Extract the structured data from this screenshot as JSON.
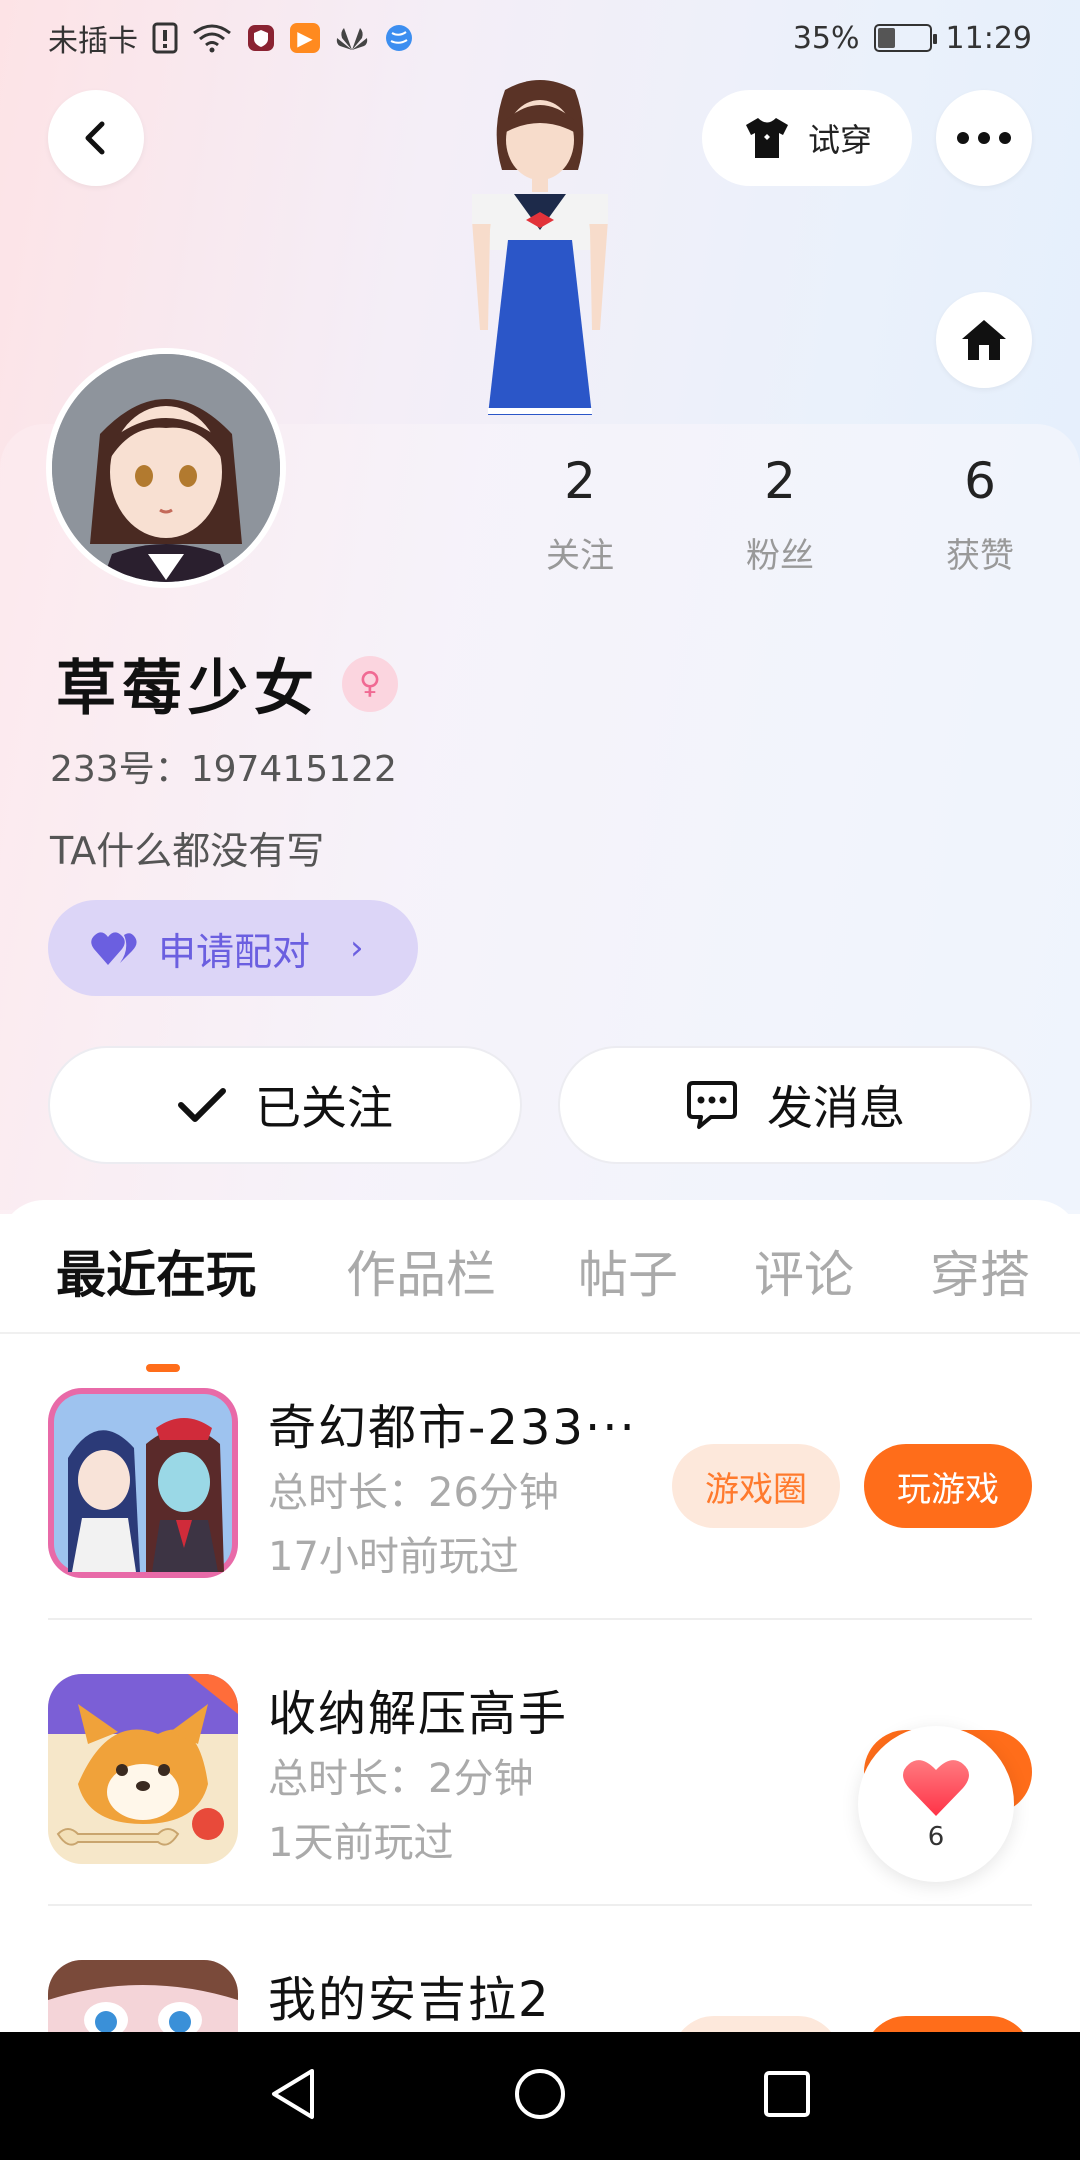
{
  "status_bar": {
    "carrier": "未插卡",
    "battery": "35",
    "battery_suffix": "%",
    "battery_level": 0.35,
    "time": "11:29"
  },
  "header": {
    "tryon_label": "试穿"
  },
  "profile": {
    "name": "草莓少女",
    "gender_symbol": "♀",
    "uid": "233号：197415122",
    "bio": "TA什么都没有写",
    "pair_label": "申请配对",
    "stats": [
      {
        "value": "2",
        "label": "关注"
      },
      {
        "value": "2",
        "label": "粉丝"
      },
      {
        "value": "6",
        "label": "获赞"
      }
    ],
    "follow_label": "已关注",
    "message_label": "发消息"
  },
  "tabs": [
    "最近在玩",
    "作品栏",
    "帖子",
    "评论",
    "穿搭"
  ],
  "games": [
    {
      "title": "奇幻都市-233···",
      "duration": "总时长：26分钟",
      "last_played": "17小时前玩过",
      "circle_label": "游戏圈",
      "play_label": "玩游戏"
    },
    {
      "title": "收纳解压高手",
      "duration": "总时长：2分钟",
      "last_played": "1天前玩过",
      "circle_label": "",
      "play_label": ""
    },
    {
      "title": "我的安吉拉2",
      "duration": "",
      "last_played": "",
      "circle_label": "",
      "play_label": ""
    }
  ],
  "floating_like": {
    "count": "6"
  },
  "colors": {
    "accent_orange": "#ff6d1a",
    "pair_purple": "#6b5fe0",
    "heart_red": "#ff4a57"
  }
}
